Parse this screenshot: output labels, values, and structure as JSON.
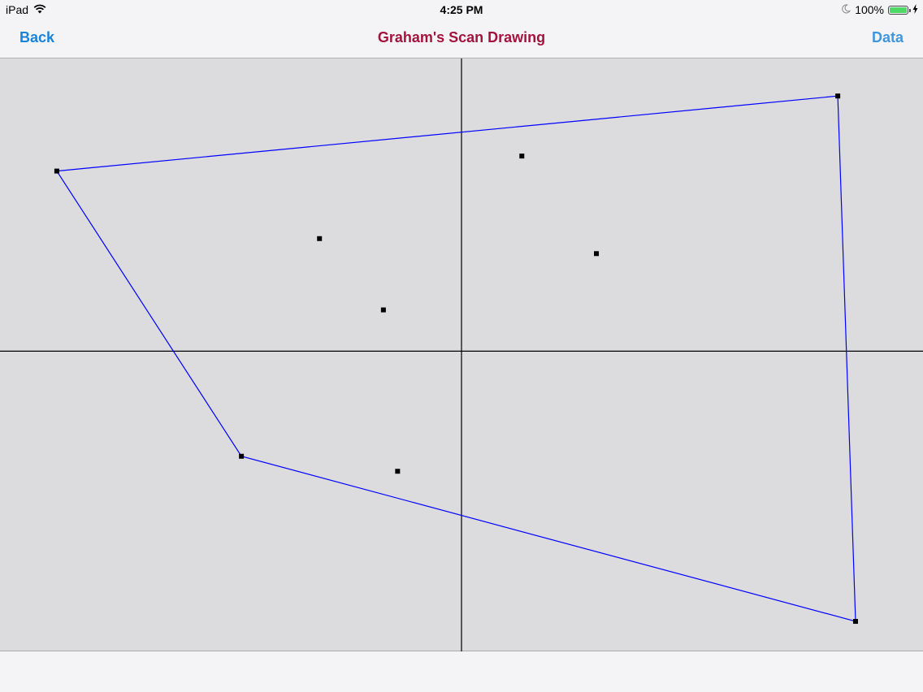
{
  "status_bar": {
    "device": "iPad",
    "time": "4:25 PM",
    "battery_percent": "100%",
    "icons": [
      "wifi-icon",
      "moon-icon",
      "battery-icon",
      "charging-bolt-icon"
    ]
  },
  "nav": {
    "back_label": "Back",
    "title": "Graham's Scan Drawing",
    "data_label": "Data"
  },
  "colors": {
    "title": "#a3133e",
    "nav_button": "#1a83d8",
    "hull": "#0000ff",
    "points": "#000000",
    "axes": "#000000",
    "canvas_background": "#dcdcde"
  },
  "chart_data": {
    "type": "scatter",
    "points": [
      {
        "x": -5.7,
        "y": 2.4
      },
      {
        "x": 5.3,
        "y": 3.4
      },
      {
        "x": 5.55,
        "y": -3.6
      },
      {
        "x": -3.1,
        "y": -1.4
      },
      {
        "x": 0.85,
        "y": 2.6
      },
      {
        "x": -2.0,
        "y": 1.5
      },
      {
        "x": 1.9,
        "y": 1.3
      },
      {
        "x": -1.1,
        "y": 0.55
      },
      {
        "x": -0.9,
        "y": -1.6
      }
    ],
    "hull_indices": [
      0,
      1,
      2,
      3
    ],
    "xlim": [
      -6.5,
      6.5
    ],
    "ylim": [
      -4.0,
      3.9
    ],
    "axes_lines": true,
    "grid": false
  }
}
